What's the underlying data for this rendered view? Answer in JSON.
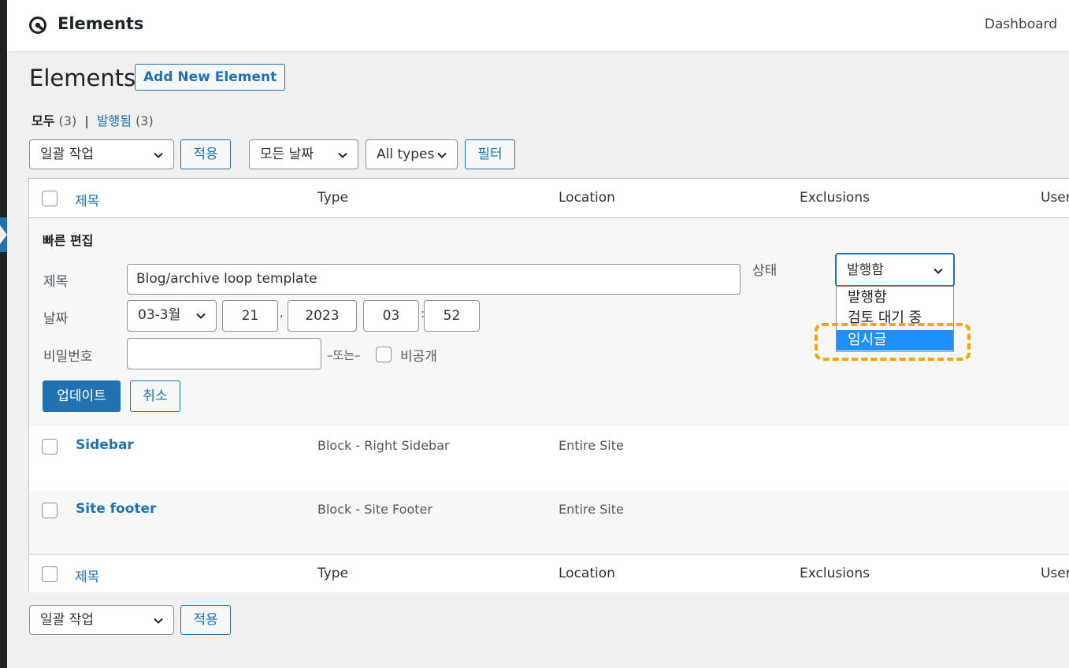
{
  "app": {
    "title": "Elements",
    "dashboard_link": "Dashboard"
  },
  "page": {
    "title": "Elements",
    "add_new_label": "Add New Element"
  },
  "filters_nav": {
    "all_label": "모두",
    "all_count": "(3)",
    "published_label": "발행됨",
    "published_count": "(3)"
  },
  "toolbar": {
    "bulk_action": "일괄 작업",
    "apply": "적용",
    "dates": "모든 날짜",
    "types": "All types",
    "filter": "필터"
  },
  "table": {
    "columns": [
      "제목",
      "Type",
      "Location",
      "Exclusions",
      "Users"
    ],
    "rows": [
      {
        "title": "Sidebar",
        "type": "Block - Right Sidebar",
        "location": "Entire Site"
      },
      {
        "title": "Site footer",
        "type": "Block - Site Footer",
        "location": "Entire Site"
      }
    ]
  },
  "quick_edit": {
    "heading": "빠른 편집",
    "title_label": "제목",
    "title_value": "Blog/archive loop template",
    "date_label": "날짜",
    "month": "03-3월",
    "day": "21",
    "year": "2023",
    "hour": "03",
    "minute": "52",
    "comma": ",",
    "colon": ":",
    "password_label": "비밀번호",
    "or_text": "–또는–",
    "private_label": "비공개",
    "status_label": "상태",
    "status_value": "발행함",
    "status_options": [
      "발행함",
      "검토 대기 중",
      "임시글"
    ],
    "update_button": "업데이트",
    "cancel_button": "취소"
  },
  "bottom_toolbar": {
    "bulk_action": "일괄 작업",
    "apply": "적용"
  },
  "colors": {
    "accent": "#2271b1",
    "highlight": "#f6a609",
    "selected_option": "#1e90ff"
  }
}
